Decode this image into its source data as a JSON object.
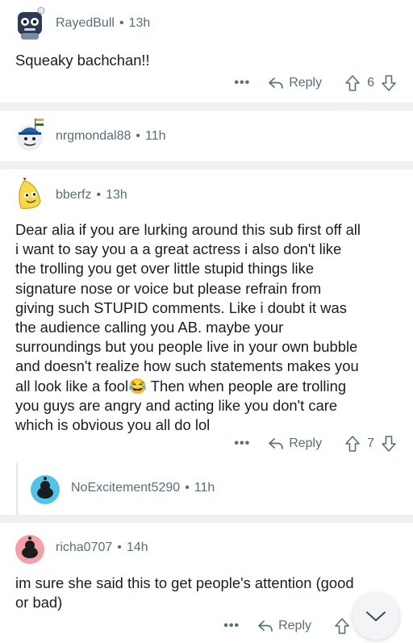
{
  "comments": [
    {
      "author": "RayedBull",
      "time": "13h",
      "body": "Squeaky bachchan!!",
      "reply_label": "Reply",
      "votes": "6"
    },
    {
      "author": "nrgmondal88",
      "time": "11h"
    },
    {
      "author": "bberfz",
      "time": "13h",
      "body_lines": [
        "Dear alia if you are lurking around this sub first off all",
        "i want to say you a a great actress i also don't like",
        "the trolling you get over little stupid things like",
        "signature nose or voice but please refrain from",
        "giving such STUPID comments. Like i doubt it was",
        "the audience calling you AB. maybe your",
        "surroundings but you people live in your own bubble",
        "and doesn't realize how such statements makes you",
        "all look like a fool",
        " Then when people are trolling",
        "you guys are angry and acting like you don't care",
        "which is obvious you all do lol"
      ],
      "emoji": "😂",
      "reply_label": "Reply",
      "votes": "7"
    },
    {
      "author": "NoExcitement5290",
      "time": "11h"
    },
    {
      "author": "richa0707",
      "time": "14h",
      "body_lines": [
        "im sure she said this to get people's attention (good",
        "or bad)"
      ],
      "reply_label": "Reply"
    }
  ],
  "separator": "•",
  "more_label": "•••",
  "colors": {
    "meta": "#576f76",
    "divider": "#eef0f1",
    "thread": "#e3e6e8"
  },
  "icons": [
    "reply-arrow-icon",
    "upvote-icon",
    "downvote-icon",
    "chevron-down-icon",
    "more-options-icon"
  ]
}
